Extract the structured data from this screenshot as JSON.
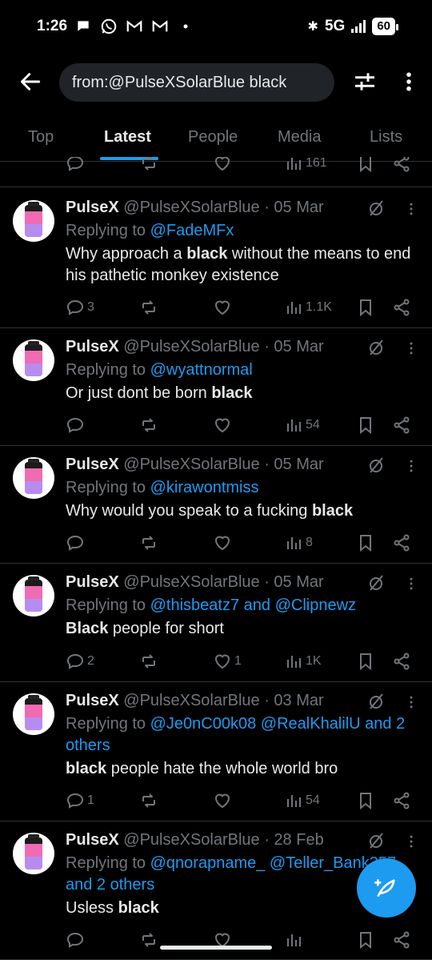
{
  "status_bar": {
    "time": "1:26",
    "network": "5G",
    "battery": "60",
    "bluetooth_glyph": "✱"
  },
  "search": {
    "query": "from:@PulseXSolarBlue black"
  },
  "tabs": [
    {
      "label": "Top",
      "active": false
    },
    {
      "label": "Latest",
      "active": true
    },
    {
      "label": "People",
      "active": false
    },
    {
      "label": "Media",
      "active": false
    },
    {
      "label": "Lists",
      "active": false
    }
  ],
  "prev_tweet": {
    "views": "161"
  },
  "reply_prefix": "Replying to ",
  "tweets": [
    {
      "name": "PulseX",
      "handle": "@PulseXSolarBlue",
      "date": "· 05 Mar",
      "replying_to": "@FadeMFx",
      "text": "Why approach a black without the means to end his pathetic monkey existence",
      "replies": "3",
      "reposts": "",
      "likes": "",
      "views": "1.1K"
    },
    {
      "name": "PulseX",
      "handle": "@PulseXSolarBlue",
      "date": "· 05 Mar",
      "replying_to": "@wyattnormal",
      "text": "Or just dont be born black",
      "replies": "",
      "reposts": "",
      "likes": "",
      "views": "54"
    },
    {
      "name": "PulseX",
      "handle": "@PulseXSolarBlue",
      "date": "· 05 Mar",
      "replying_to": "@kirawontmiss",
      "text": "Why would you speak to a fucking black",
      "replies": "",
      "reposts": "",
      "likes": "",
      "views": "8"
    },
    {
      "name": "PulseX",
      "handle": "@PulseXSolarBlue",
      "date": "· 05 Mar",
      "replying_to": "@thisbeatz7 and @Clipnewz",
      "text": "Black people for short",
      "replies": "2",
      "reposts": "",
      "likes": "1",
      "views": "1K"
    },
    {
      "name": "PulseX",
      "handle": "@PulseXSolarBlue",
      "date": "· 03 Mar",
      "replying_to": "@Je0nC00k08 @RealKhalilU and 2 others",
      "text": "black people hate the whole world bro",
      "replies": "1",
      "reposts": "",
      "likes": "",
      "views": "54"
    },
    {
      "name": "PulseX",
      "handle": "@PulseXSolarBlue",
      "date": "· 28 Feb",
      "replying_to": "@qnorapname_ @Teller_Bank357 and 2 others",
      "text": "Usless black",
      "replies": "",
      "reposts": "",
      "likes": "",
      "views": ""
    }
  ],
  "colors": {
    "accent": "#1d9bf0",
    "background": "#000000",
    "muted": "#71767b",
    "text": "#e7e9ea"
  }
}
